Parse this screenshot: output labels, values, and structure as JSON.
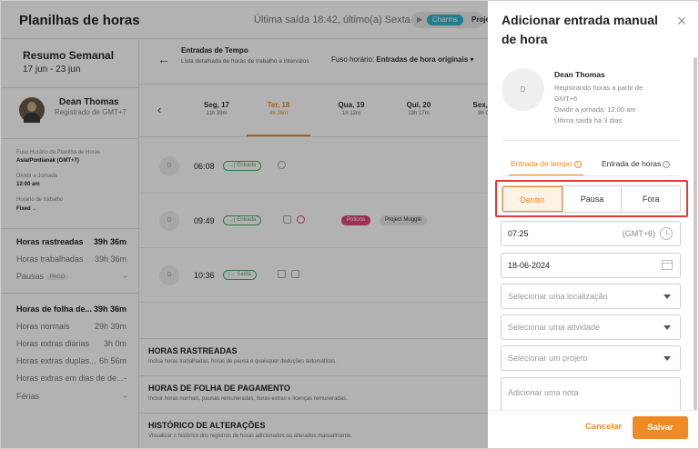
{
  "app": {
    "title": "Planilhas de horas",
    "last_out": "Última saída 18:42, último(a) Sexta-feira",
    "chip_tag": "Charms",
    "chip_project": "Proje"
  },
  "sidebar": {
    "week_title": "Resumo Semanal",
    "week_range": "17 jun - 23 jun",
    "user_name": "Dean Thomas",
    "user_sub": "Registrado de GMT+7",
    "tz_label": "Fuso Horário da Planilha de Horas",
    "tz_value": "Asia/Pontianak (GMT+7)",
    "split_label": "Dividir a Jornada",
    "split_value": "12:00 am",
    "schedule_label": "Horário de trabalho",
    "schedule_value": "Fixed",
    "rows": [
      {
        "label": "Horas rastreadas",
        "value": "39h 36m"
      },
      {
        "label": "Horas trabalhadas",
        "value": "39h 36m"
      },
      {
        "label": "Pausas",
        "badge": "PAGO",
        "value": "-"
      },
      {
        "label": "Horas de folha de...",
        "value": "39h 36m"
      },
      {
        "label": "Horas normais",
        "value": "29h 39m"
      },
      {
        "label": "Horas extras diárias",
        "value": "3h 0m"
      },
      {
        "label": "Horas extras duplas...",
        "value": "6h 56m"
      },
      {
        "label": "Horas extras em dias de de...",
        "value": "-"
      },
      {
        "label": "Férias",
        "value": "-"
      }
    ]
  },
  "main": {
    "header_title": "Entradas de Tempo",
    "header_sub": "Lista detalhada de horas de trabalho e intervalos",
    "tz_label": "Fuso horário:",
    "tz_value": "Entradas de hora originais",
    "days": [
      {
        "name": "Seg, 17",
        "hours": "11h 39m"
      },
      {
        "name": "Ter, 18",
        "hours": "4h 28m"
      },
      {
        "name": "Qua, 19",
        "hours": "1h 12m"
      },
      {
        "name": "Qui, 20",
        "hours": "13h 17m"
      },
      {
        "name": "Sex, 2",
        "hours": "9h 0"
      }
    ],
    "entries": [
      {
        "initial": "D",
        "time": "06:08",
        "type": "Entrada"
      },
      {
        "initial": "D",
        "time": "09:49",
        "type": "Entrada",
        "tag1": "Potions",
        "tag2": "Project Muggle"
      },
      {
        "initial": "D",
        "time": "10:36",
        "type": "Saída"
      }
    ],
    "sections": [
      {
        "title": "HORAS RASTREADAS",
        "sub": "Inclua horas trabalhadas, horas de pausa e quaisquer deduções automáticas."
      },
      {
        "title": "HORAS DE FOLHA DE PAGAMENTO",
        "sub": "Incluir horas normais, pausas remuneradas, horas extras e licenças remuneradas."
      },
      {
        "title": "HISTÓRICO DE ALTERAÇÕES",
        "sub": "Visualizar o histórico dos registros de horas adicionados ou alterados manualmente."
      }
    ]
  },
  "panel": {
    "title": "Adicionar entrada manual de hora",
    "close_icon": "×",
    "avatar_initial": "D",
    "user_name": "Dean Thomas",
    "info1": "Registrando horas a partir de",
    "info2": "GMT+6",
    "info3": "Dividir a jornada: 12:00 am",
    "info4": "Última saída há 3 dias",
    "tab_time": "Entrada de tempo",
    "tab_hours": "Entrada de horas",
    "segment": {
      "in": "Dentro",
      "break": "Pausa",
      "out": "Fora",
      "selected": "Dentro"
    },
    "time_value": "07:25",
    "time_zone": "(GMT+6)",
    "date_value": "18-06-2024",
    "location_placeholder": "Selecionar uma localização",
    "activity_placeholder": "Selecionar uma atividade",
    "project_placeholder": "Selecionar um projeto",
    "note_placeholder": "Adicionar uma nota",
    "cancel_label": "Cancelar",
    "save_label": "Salvar",
    "accent_color": "#f08a24",
    "highlight_color": "#e53935"
  }
}
